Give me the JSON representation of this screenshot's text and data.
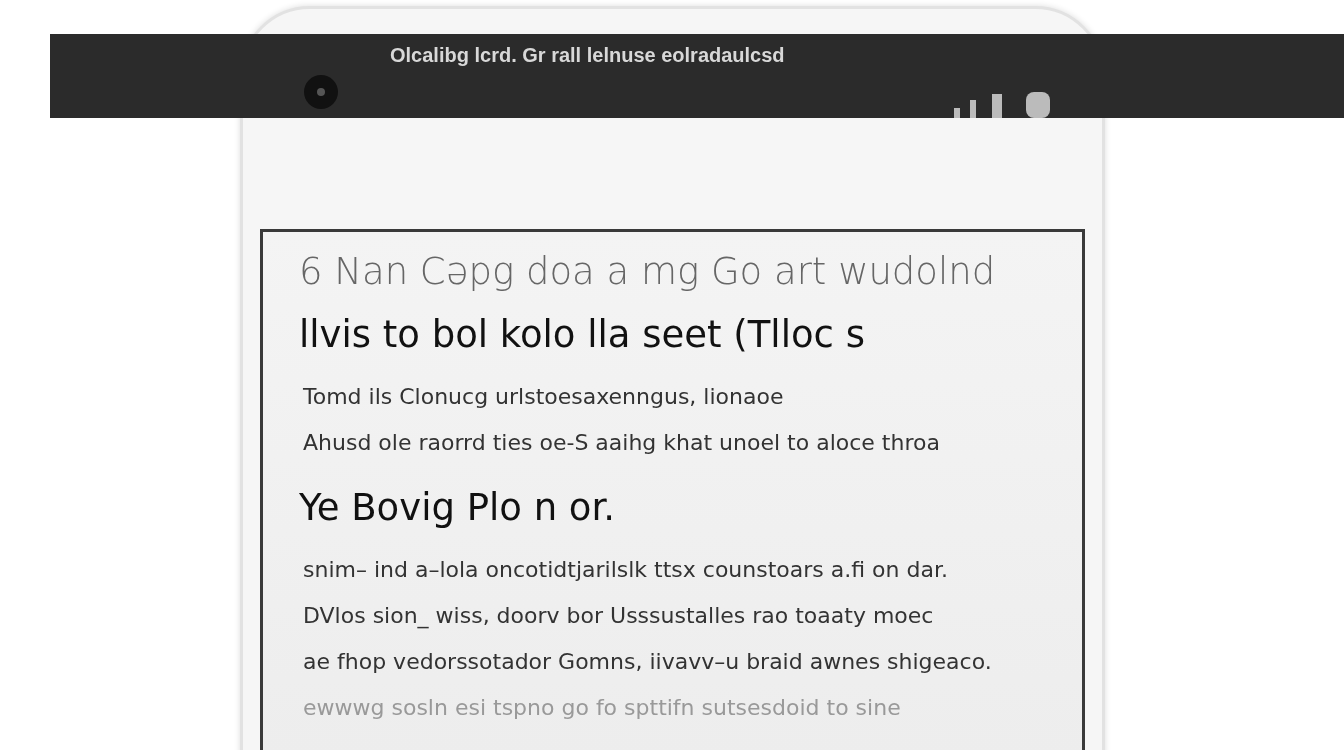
{
  "status_bar": {
    "title": "Olcalibg lcrd. Gr rall lelnuse eolradaulcsd"
  },
  "article": {
    "blocks": [
      {
        "kind": "subtitle",
        "text": "6 Nan Cəpg doa a mg Go art wudolnd"
      },
      {
        "kind": "heading",
        "text": "llvis to bol kolo lla seet (Tlloc s"
      },
      {
        "kind": "paragraph",
        "lines": [
          "Tomd ils Clonucg urlstoesaxenngus, lionaoe",
          "Ahusd ole raorrd ties oe-S aaihg khat unoel to aloce throa"
        ]
      },
      {
        "kind": "heading",
        "text": "Ye Bovig Plo n or."
      },
      {
        "kind": "paragraph",
        "lines": [
          "snim– ind a–lola oncotidtjarilslk ttsx counstoars a.fi on dar.",
          "DVlos sion_ wiss, doorv bor Usssustalles rao toaaty moec",
          "ae fhop vedorssotador Gomns, iivavv–u braid awnes shigeaco.",
          "ewwwg sosln esi tspno go fo spttifn sutsesdoid to sine"
        ]
      }
    ]
  }
}
